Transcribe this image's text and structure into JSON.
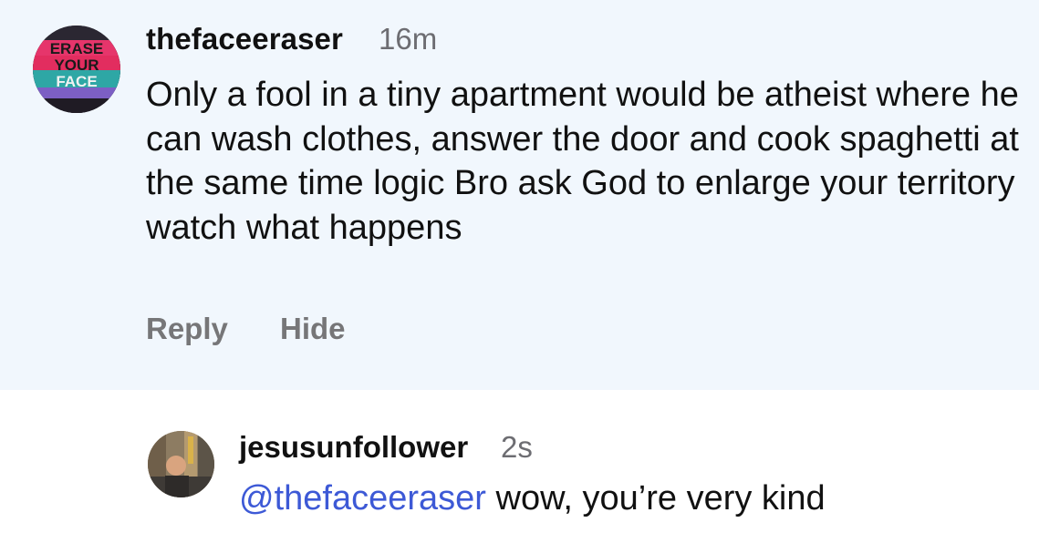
{
  "comment": {
    "username": "thefaceeraser",
    "time": "16m",
    "text": "Only a fool in a tiny apartment would be atheist where he can wash clothes, answer the door and cook spaghetti at the same time logic Bro ask God to enlarge your territory watch what happens",
    "avatar_icon": "erase-your-face-logo",
    "avatar_text": [
      "ERASE",
      "YOUR",
      "FACE"
    ],
    "actions": {
      "reply_label": "Reply",
      "hide_label": "Hide"
    },
    "highlight_color": "#f1f7fd"
  },
  "reply": {
    "username": "jesusunfollower",
    "time": "2s",
    "mention": "@thefaceeraser",
    "text": " wow, you’re very kind",
    "avatar_icon": "user-photo-avatar",
    "mention_color": "#3d59d6"
  }
}
